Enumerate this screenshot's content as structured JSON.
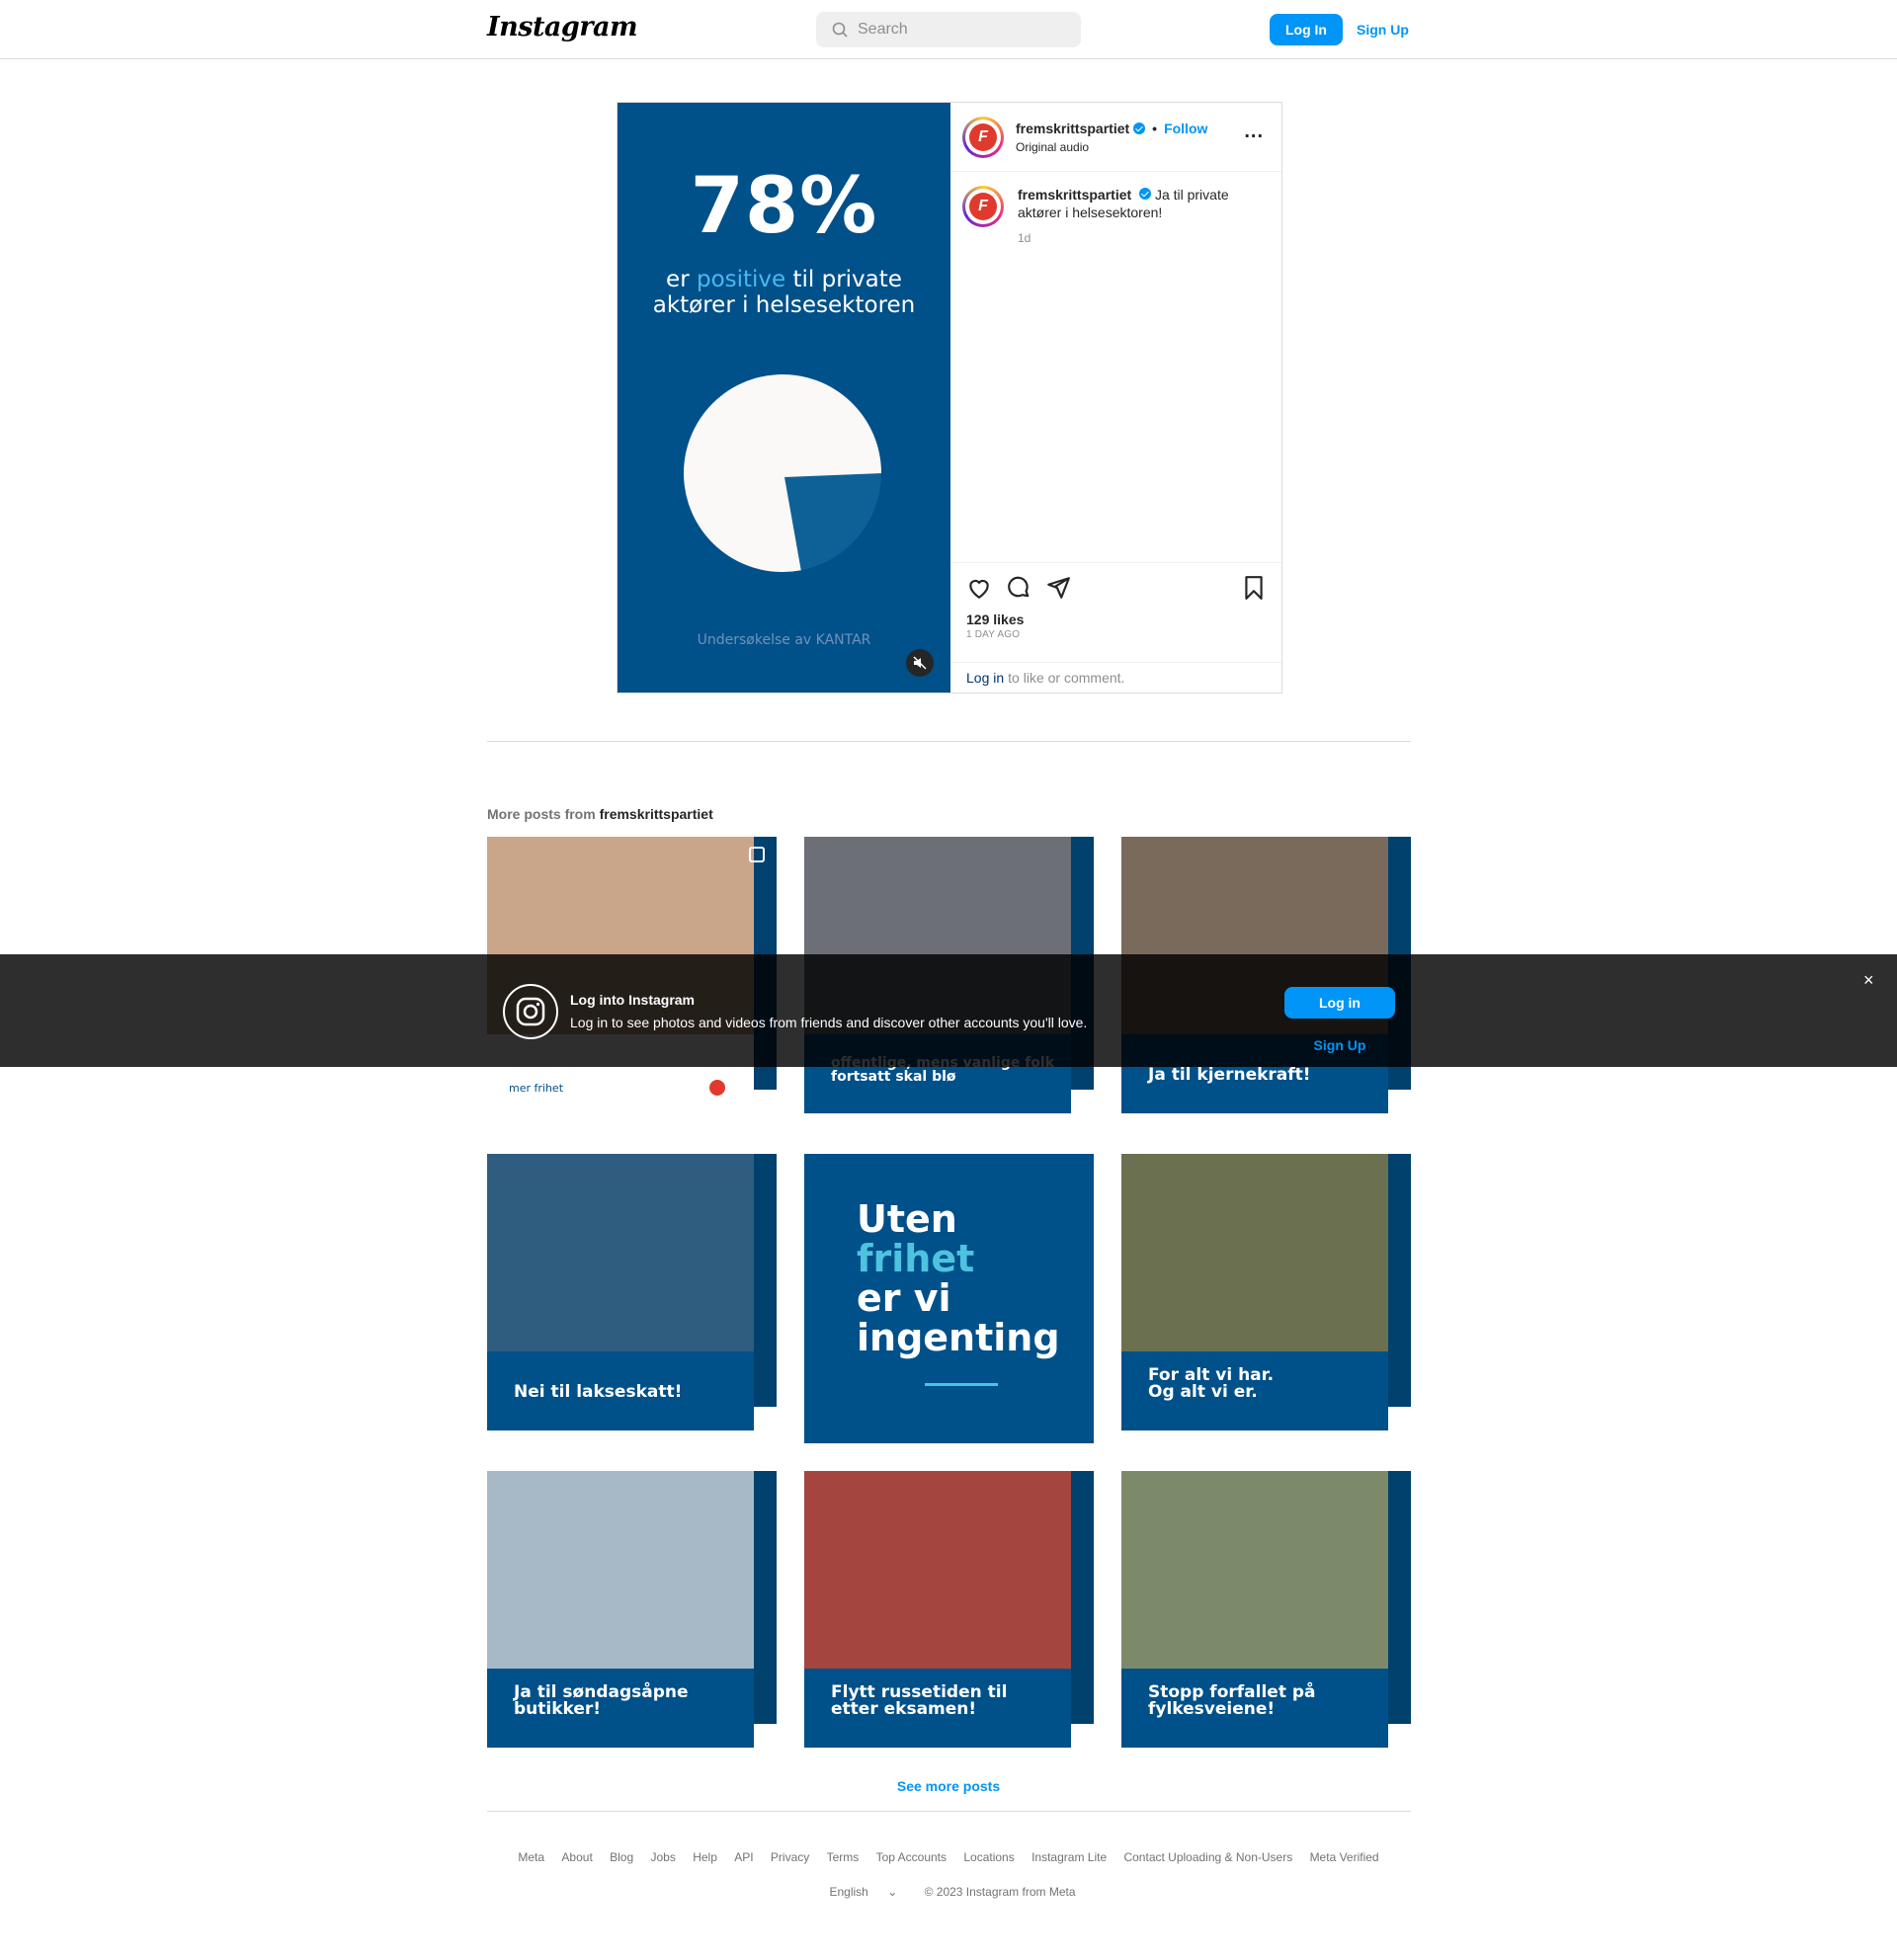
{
  "header": {
    "logo": "Instagram",
    "search_placeholder": "Search",
    "login_label": "Log In",
    "signup_label": "Sign Up"
  },
  "post": {
    "media": {
      "big_number": "78%",
      "line1_pre": "er ",
      "line1_highlight": "positive",
      "line1_post": " til private",
      "line2": "aktører i helsesektoren",
      "source": "Undersøkelse av KANTAR",
      "pie_percent": 78
    },
    "author": "fremskrittspartiet",
    "dot": "•",
    "follow_label": "Follow",
    "audio": "Original audio",
    "more_label": "...",
    "caption": "Ja til private aktører i helsesektoren!",
    "caption_time": "1d",
    "likes": "129 likes",
    "ago": "1 DAY AGO",
    "login_link": "Log in",
    "login_rest": "to like or comment."
  },
  "more_posts": {
    "title_prefix": "More posts from",
    "title_user": "fremskrittspartiet",
    "tiles": [
      {
        "text": "",
        "footer": "mer frihet",
        "photo_color": "#c9a68a"
      },
      {
        "text": "offentlige, mens vanlige folk fortsatt skal blø",
        "footer": "",
        "photo_color": "#6c6f76"
      },
      {
        "text": "Ja til kjernekraft!",
        "footer": "",
        "photo_color": "#7a6a5c"
      },
      {
        "text": "Nei til lakseskatt!",
        "footer": "",
        "photo_color": "#2f5d80"
      },
      {
        "full_line1": "Uten",
        "full_line2": "frihet",
        "full_line3": "er vi",
        "full_line4": "ingenting"
      },
      {
        "text": "For alt vi har. Og alt vi er.",
        "footer": "",
        "photo_color": "#6b7050"
      },
      {
        "text": "Ja til søndagsåpne butikker!",
        "footer": "",
        "photo_color": "#a7b9c7"
      },
      {
        "text": "Flytt russetiden til etter eksamen!",
        "footer": "",
        "photo_color": "#a4453f"
      },
      {
        "text": "Stopp forfallet på fylkesveiene!",
        "footer": "",
        "photo_color": "#7c8a6a"
      }
    ],
    "see_more": "See more posts"
  },
  "footer": {
    "links": [
      "Meta",
      "About",
      "Blog",
      "Jobs",
      "Help",
      "API",
      "Privacy",
      "Terms",
      "Top Accounts",
      "Locations",
      "Instagram Lite",
      "Contact Uploading & Non-Users",
      "Meta Verified"
    ],
    "language": "English",
    "copyright": "© 2023 Instagram from Meta"
  },
  "banner": {
    "title": "Log into Instagram",
    "text": "Log in to see photos and videos from friends and discover other accounts you'll love.",
    "login_label": "Log in",
    "signup_label": "Sign Up",
    "close_label": "×"
  }
}
